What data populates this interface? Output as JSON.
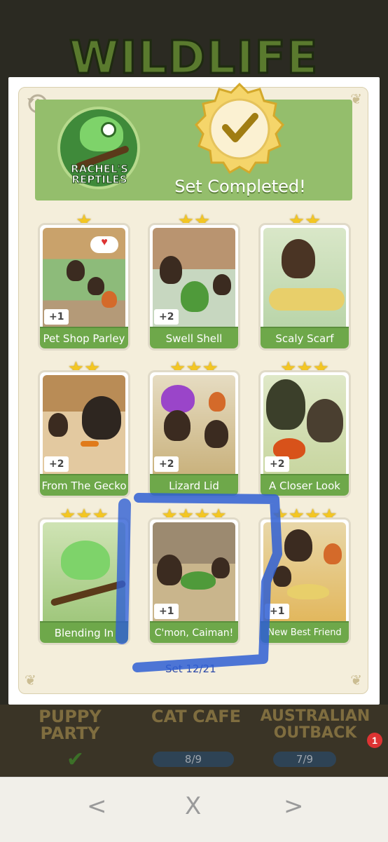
{
  "background_title": "WILDLIFE",
  "album": {
    "badge_label_line1": "RACHEL'S",
    "badge_label_line2": "REPTILES",
    "status": "Set Completed!",
    "set_counter": "Set 12/21"
  },
  "stickers": [
    {
      "name": "Pet Shop Parley",
      "stars": 1,
      "bonus": "+1"
    },
    {
      "name": "Swell Shell",
      "stars": 2,
      "bonus": "+2"
    },
    {
      "name": "Scaly Scarf",
      "stars": 2,
      "bonus": ""
    },
    {
      "name": "From The Gecko",
      "stars": 2,
      "bonus": "+2"
    },
    {
      "name": "Lizard Lid",
      "stars": 3,
      "bonus": "+2"
    },
    {
      "name": "A Closer Look",
      "stars": 3,
      "bonus": "+2"
    },
    {
      "name": "Blending In",
      "stars": 3,
      "bonus": ""
    },
    {
      "name": "C'mon, Caiman!",
      "stars": 4,
      "bonus": "+1"
    },
    {
      "name": "New Best Friend",
      "stars": 4,
      "bonus": "+1"
    }
  ],
  "background_sets": [
    {
      "name_line1": "PUPPY",
      "name_line2": "PARTY",
      "progress": ""
    },
    {
      "name_line1": "CAT CAFE",
      "name_line2": "",
      "progress": "8/9"
    },
    {
      "name_line1": "AUSTRALIAN",
      "name_line2": "OUTBACK",
      "progress": "7/9"
    }
  ],
  "notification_count": "1",
  "nav": {
    "prev": "<",
    "close": "X",
    "next": ">"
  },
  "colors": {
    "header_green": "#94be6c",
    "label_green": "#6ea84a",
    "marker_blue": "#2f5fd4",
    "star_gold": "#f3c623"
  }
}
